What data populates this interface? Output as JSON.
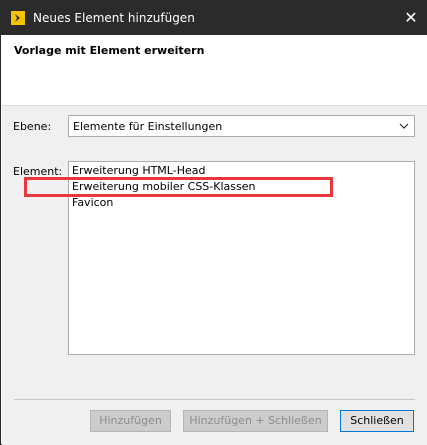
{
  "window": {
    "title": "Neues Element hinzufügen",
    "close_glyph": "✕",
    "app_icon": "app-logo-icon"
  },
  "header": {
    "title": "Vorlage mit Element erweitern"
  },
  "form": {
    "level_label": "Ebene:",
    "level_value": "Elemente für Einstellungen",
    "element_label": "Element:",
    "elements": [
      "Erweiterung HTML-Head",
      "Erweiterung mobiler CSS-Klassen",
      "Favicon"
    ],
    "highlighted_element": "Erweiterung mobiler CSS-Klassen"
  },
  "buttons": {
    "add": "Hinzufügen",
    "add_close": "Hinzufügen + Schließen",
    "close": "Schließen"
  },
  "colors": {
    "titlebar": "#2b2b2b",
    "highlight": "#e8383d",
    "app_icon": "#f5c400"
  }
}
